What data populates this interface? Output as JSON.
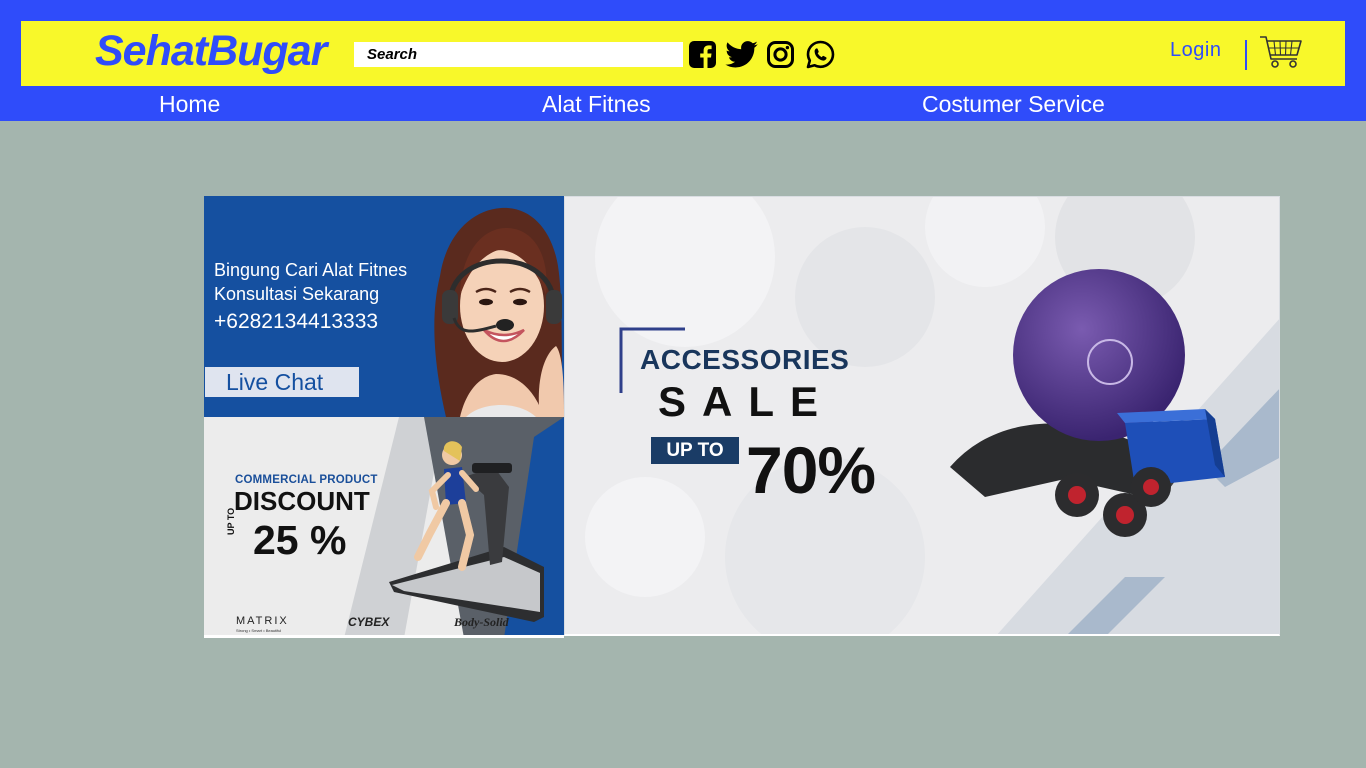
{
  "header": {
    "logo": "SehatBugar",
    "search_placeholder": "Search",
    "login_label": "Login",
    "social_icons": [
      "facebook-icon",
      "twitter-icon",
      "instagram-icon",
      "whatsapp-icon"
    ],
    "cart_icon": "shopping-cart-icon"
  },
  "nav": {
    "items": [
      {
        "label": "Home"
      },
      {
        "label": "Alat Fitnes"
      },
      {
        "label": "Costumer Service"
      }
    ]
  },
  "customer_service_banner": {
    "line1": "Bingung Cari Alat Fitnes",
    "line2": "Konsultasi Sekarang",
    "phone": "+6282134413333",
    "live_chat_label": "Live Chat"
  },
  "discount_banner": {
    "tag": "COMMERCIAL PRODUCT",
    "headline": "DISCOUNT",
    "up_to": "UP TO",
    "percent": "25 %",
    "brands": [
      "MATRIX",
      "CYBEX",
      "Body-Solid"
    ],
    "brand_tagline": "Strong • Smart • Beautiful"
  },
  "accessories_banner": {
    "headline": "ACCESSORIES",
    "sale": "SALE",
    "up_to": "UP TO",
    "percent": "70%"
  },
  "colors": {
    "brand_blue": "#2f4cfa",
    "header_yellow": "#f8f82a",
    "page_background": "#a4b5ae",
    "banner_blue": "#1550a0"
  }
}
